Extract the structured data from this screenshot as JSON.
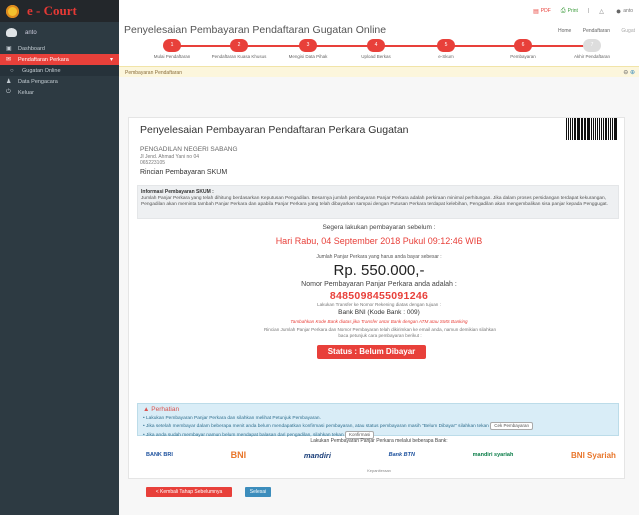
{
  "app": {
    "logo_text": "e - Court"
  },
  "user": {
    "name": "anto"
  },
  "sidebar": {
    "items": [
      {
        "icon": "dashboard-icon",
        "glyph": "▣",
        "label": "Dashboard"
      },
      {
        "icon": "folder-icon",
        "glyph": "✉",
        "label": "Pendaftaran Perkara"
      },
      {
        "icon": "circle-icon",
        "glyph": "○",
        "label": "Gugatan Online"
      },
      {
        "icon": "user-icon",
        "glyph": "♟",
        "label": "Data Pengacara"
      },
      {
        "icon": "logout-icon",
        "glyph": "⏻",
        "label": "Keluar"
      }
    ]
  },
  "topbar": {
    "pdf_label": "PDF",
    "print_label": "Print",
    "user_label": "anto"
  },
  "header": {
    "title": "Penyelesaian Pembayaran Pendaftaran Gugatan Online",
    "breadcrumb": [
      "Home",
      "Pendaftaran",
      "Gugat"
    ]
  },
  "steps": [
    {
      "num": "1",
      "label": "Mulai Pendaftaran"
    },
    {
      "num": "2",
      "label": "Pendaftaran Kuasa Khusus"
    },
    {
      "num": "3",
      "label": "Mengisi Data Pihak"
    },
    {
      "num": "4",
      "label": "Upload Berkas"
    },
    {
      "num": "5",
      "label": "e-Skum"
    },
    {
      "num": "6",
      "label": "Pembayaran"
    },
    {
      "num": "7",
      "label": "Akhir Pendaftaran"
    }
  ],
  "panel": {
    "heading": "Pembayaran Pendaftaran"
  },
  "card": {
    "title": "Penyelesaian Pembayaran Pendaftaran Perkara Gugatan",
    "court_name": "PENGADILAN NEGERI SABANG",
    "address": "Jl Jend. Ahmad Yani no 04",
    "phone": "065223105",
    "rincian": "Rincian Pembayaran SKUM",
    "info_title": "Informasi Pembayaran SKUM :",
    "info_text": "Jumlah Panjar Perkara yang telah dihitung berdasarkan Keputusan Pengadilan. Besarnya jumlah pembayaran Panjar Perkara adalah perkiraan minimal perhitungan. Jika dalam proses persidangan terdapat kekurangan, Pengadilan akan meminta tambah Panjar Perkara dan apabila Panjar Perkara yang telah dibayarkan sampai dengan Putusan Perkara terdapat kelebihan, Pengadilan akan mengembalikan sisa panjar kepada Penggugat.",
    "segera": "Segera lakukan pembayaran sebelum :",
    "deadline": "Hari Rabu, 04 September 2018 Pukul 09:12:46 WIB",
    "jumlah_label": "Jumlah Panjar Perkara yang harus anda bayar sebesar :",
    "amount": "Rp. 550.000,-",
    "nomor_label": "Nomor Pembayaran Panjar Perkara anda adalah :",
    "nomor": "8485098455091246",
    "transfer_label": "Lakukan Transfer ke Nomor Rekening diatas dengan tujuan :",
    "bank_name": "Bank BNI (Kode Bank : 009)",
    "kode_note": "Tambahkan Kode Bank diatas jika Transfer antar Bank dengan ATM atau SMS Banking",
    "rincian_note": "Rincian Jumlah Panjar Perkara dan Nomor Pembayaran telah dikirimkan ke email anda, namun demikian silahkan baca petunjuk cara pembayaran berikut :",
    "status": "Status : Belum Dibayar"
  },
  "alert": {
    "title": "Perhatian",
    "line1": "Lakukan Pembayaran Panjar Perkara dan silahkan melihat Petunjuk Pembayaran.",
    "line2": "Jika setelah membayar dalam beberapa menit anda belum mendapatkan konfirmasi pembayaran, atau status pembayaran masih \"Belum Dibayar\" silahkan tekan",
    "cek_label": "Cek Pembayaran",
    "line3": "Jika anda sudah membayar namun belum mendapat balasan dari pengadilan, silahkan tekan",
    "konfirmasi_label": "Konfirmasi"
  },
  "banks": {
    "title": "Lakukan Pembayaran Panjar Perkara melalui beberapa Bank:",
    "list": [
      {
        "name": "BANK BRI",
        "color": "#1a4f9c"
      },
      {
        "name": "BNI",
        "color": "#e8762b"
      },
      {
        "name": "mandiri",
        "color": "#1b3f7a"
      },
      {
        "name": "Bank BTN",
        "color": "#1a4f9c"
      },
      {
        "name": "mandiri syariah",
        "color": "#0a7d48"
      },
      {
        "name": "BNI Syariah",
        "color": "#e8762b"
      }
    ]
  },
  "footer": {
    "note": "Kepaniteraan"
  },
  "actions": {
    "back_label": "< Kembali Tahap Sebelumnya",
    "next_label": "Selesai"
  }
}
